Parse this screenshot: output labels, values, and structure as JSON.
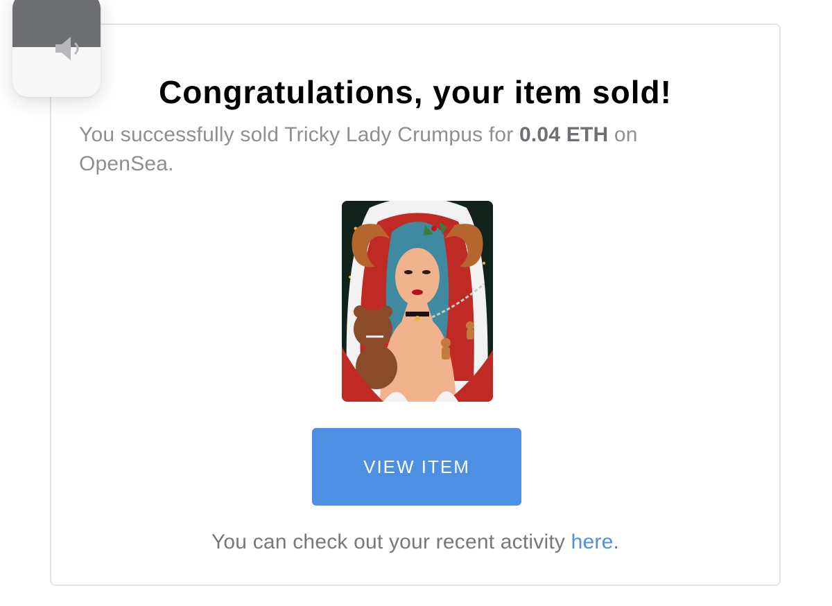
{
  "volume_hud": {
    "icon": "speaker-icon",
    "level": 0.52,
    "fill_color": "#6c6e72"
  },
  "email": {
    "headline": "Congratulations, your item sold!",
    "message": {
      "prefix": "You successfully sold Tricky Lady Crumpus for ",
      "price": "0.04 ETH",
      "suffix": " on OpenSea."
    },
    "item_image": {
      "kind": "nft-artwork"
    },
    "view_button_label": "VIEW ITEM",
    "footer": {
      "prefix": "You can check out your recent activity ",
      "link_text": "here",
      "suffix": "."
    }
  },
  "colors": {
    "accent": "#4d8fe3",
    "headline": "#000000",
    "body_text": "#8e8e93",
    "card_border": "#e2e3eb"
  }
}
